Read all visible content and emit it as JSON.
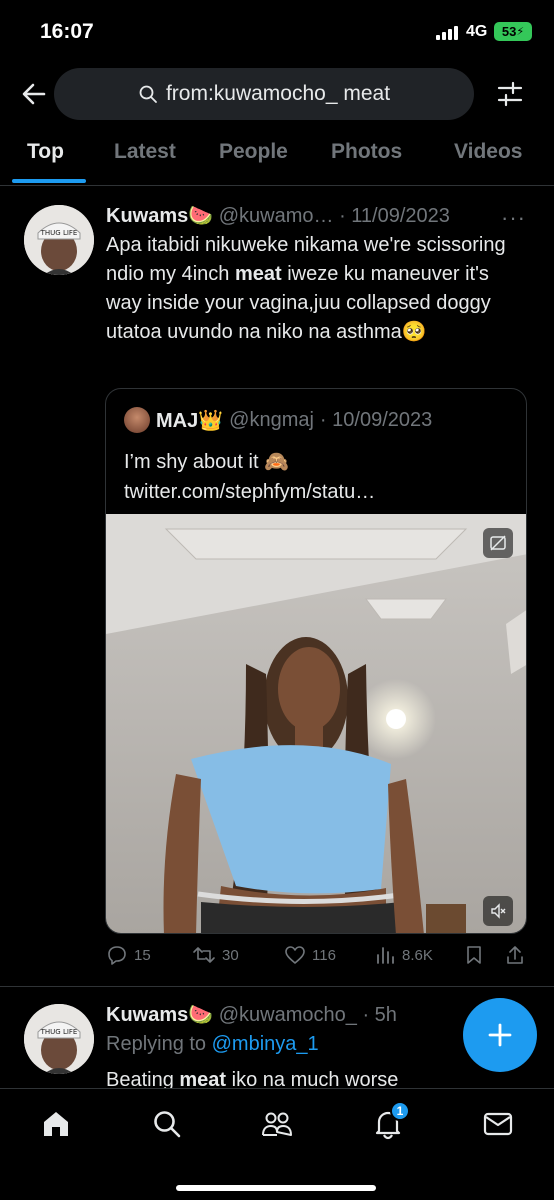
{
  "status_bar": {
    "time": "16:07",
    "network": "4G",
    "battery": "53"
  },
  "search": {
    "query": "from:kuwamocho_ meat"
  },
  "tabs": [
    {
      "label": "Top",
      "active": true
    },
    {
      "label": "Latest",
      "active": false
    },
    {
      "label": "People",
      "active": false
    },
    {
      "label": "Photos",
      "active": false
    },
    {
      "label": "Videos",
      "active": false
    }
  ],
  "tweet1": {
    "name": "Kuwams",
    "name_emoji": "🍉",
    "handle": "@kuwamo…",
    "date": "· 11/09/2023",
    "more": "···",
    "text_1": "Apa itabidi nikuweke nikama we're scissoring ndio my 4inch ",
    "text_bold": "meat",
    "text_2": " iweze ku maneuver it's way inside your vagina,juu collapsed doggy utatoa uvundo na niko na asthma",
    "text_emoji": "🥺",
    "quote": {
      "name": "MAJ",
      "name_emoji": "👑",
      "handle": "@kngmaj",
      "date": "· 10/09/2023",
      "text": "I’m shy about it 🙈 twitter.com/stephfym/statu…"
    },
    "actions": {
      "replies": "15",
      "retweets": "30",
      "likes": "116",
      "views": "8.6K"
    }
  },
  "tweet2": {
    "name": "Kuwams",
    "name_emoji": "🍉",
    "handle": "@kuwamocho_",
    "date": "· 5h",
    "replying_prefix": "Replying to ",
    "replying_to": "@mbinya_1",
    "text_1": "Beating ",
    "text_bold": "meat",
    "text_2": " iko na much worse"
  },
  "bottom_nav": {
    "notifications_badge": "1"
  },
  "colors": {
    "accent": "#1d9bf0",
    "muted": "#71767b",
    "background": "#000000",
    "battery": "#34c759"
  }
}
